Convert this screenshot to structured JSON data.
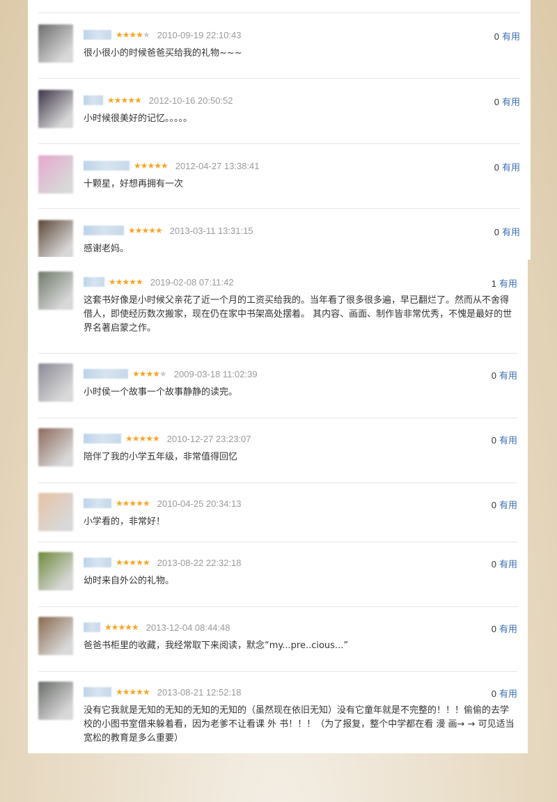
{
  "reviews_top": [
    {
      "date": "2010-09-19 22:10:43",
      "stars": 4,
      "useful_count": "0",
      "useful_label": "有用",
      "text": "很小很小的时候爸爸买给我的礼物~~~",
      "avatar_color": "#6d6d6d"
    },
    {
      "date": "2012-10-16 20:50:52",
      "stars": 5,
      "useful_count": "0",
      "useful_label": "有用",
      "text": "小时候很美好的记忆。。。。。",
      "avatar_color": "#3d3448"
    },
    {
      "date": "2012-04-27 13:38:41",
      "stars": 5,
      "useful_count": "0",
      "useful_label": "有用",
      "text": "十颗星，好想再拥有一次",
      "avatar_color": "#e7a8cf"
    },
    {
      "date": "2013-03-11 13:31:15",
      "stars": 5,
      "useful_count": "0",
      "useful_label": "有用",
      "text": "感谢老妈。",
      "avatar_color": "#5d4636"
    }
  ],
  "reviews_bottom": [
    {
      "date": "2019-02-08 07:11:42",
      "stars": 5,
      "useful_count": "1",
      "useful_label": "有用",
      "text": "这套书好像是小时候父亲花了近一个月的工资买给我的。当年看了很多很多遍，早已翻烂了。然而从不舍得借人，即使经历数次搬家，现在仍在家中书架高处摆着。 其内容、画面、制作皆非常优秀，不愧是最好的世界名著启蒙之作。",
      "avatar_color": "#6f7a6a"
    },
    {
      "date": "2009-03-18 11:02:39",
      "stars": 4,
      "useful_count": "0",
      "useful_label": "有用",
      "text": "小时侯一个故事一个故事静静的读完。",
      "avatar_color": "#8d8a96"
    },
    {
      "date": "2010-12-27 23:23:07",
      "stars": 5,
      "useful_count": "0",
      "useful_label": "有用",
      "text": "陪伴了我的小学五年级，非常值得回忆",
      "avatar_color": "#8e6a5c"
    },
    {
      "date": "2010-04-25 20:34:13",
      "stars": 5,
      "useful_count": "0",
      "useful_label": "有用",
      "text": "小学看的，非常好！",
      "avatar_color": "#e7c2a4"
    },
    {
      "date": "2013-08-22 22:32:18",
      "stars": 5,
      "useful_count": "0",
      "useful_label": "有用",
      "text": "幼时来自外公的礼物。",
      "avatar_color": "#6f8a3a"
    },
    {
      "date": "2013-12-04 08:44:48",
      "stars": 5,
      "useful_count": "0",
      "useful_label": "有用",
      "text": "爸爸书柜里的收藏，我经常取下来阅读，默念“my...pre..cious...”",
      "avatar_color": "#8a6a4d"
    },
    {
      "date": "2013-08-21 12:52:18",
      "stars": 5,
      "useful_count": "0",
      "useful_label": "有用",
      "text": "没有它我就是无知的无知的无知的无知的（虽然现在依旧无知）没有它童年就是不完整的！！！偷偷的去学校的小图书室借来躲着看，因为老爹不让看课 外 书！！！（为了报复，整个中学都在看 漫 画→ → 可见适当宽松的教育是多么重要）",
      "avatar_color": "#6a6e6a"
    }
  ]
}
